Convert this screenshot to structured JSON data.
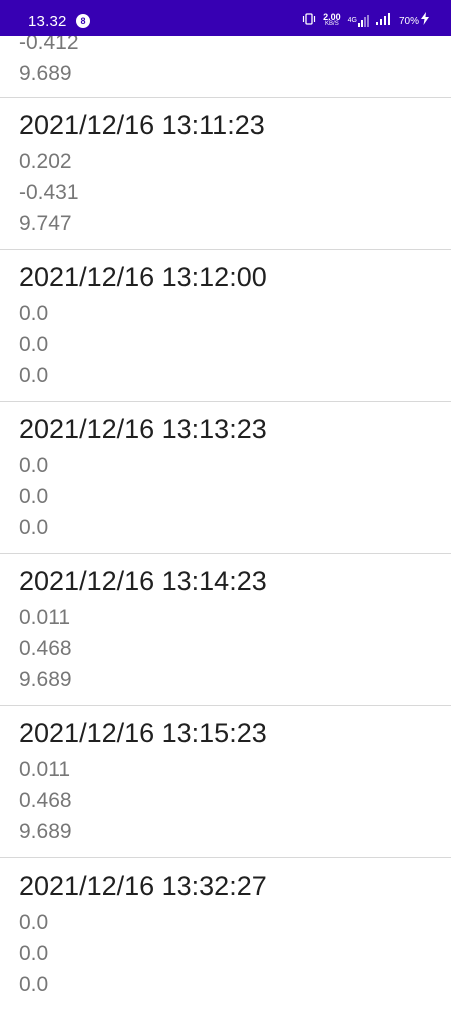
{
  "status_bar": {
    "time": "13.32",
    "notification_count": "8",
    "net_speed_value": "2.00",
    "net_speed_unit": "KB/S",
    "network_type": "4G",
    "battery": "70%",
    "background_color": "#3700b3"
  },
  "list": {
    "partial_entry": {
      "values": [
        "-0.412",
        "9.689"
      ]
    },
    "entries": [
      {
        "timestamp": "2021/12/16 13:11:23",
        "values": [
          "0.202",
          "-0.431",
          "9.747"
        ]
      },
      {
        "timestamp": "2021/12/16 13:12:00",
        "values": [
          "0.0",
          "0.0",
          "0.0"
        ]
      },
      {
        "timestamp": "2021/12/16 13:13:23",
        "values": [
          "0.0",
          "0.0",
          "0.0"
        ]
      },
      {
        "timestamp": "2021/12/16 13:14:23",
        "values": [
          "0.011",
          "0.468",
          "9.689"
        ]
      },
      {
        "timestamp": "2021/12/16 13:15:23",
        "values": [
          "0.011",
          "0.468",
          "9.689"
        ]
      },
      {
        "timestamp": "2021/12/16 13:32:27",
        "values": [
          "0.0",
          "0.0",
          "0.0"
        ]
      }
    ]
  }
}
